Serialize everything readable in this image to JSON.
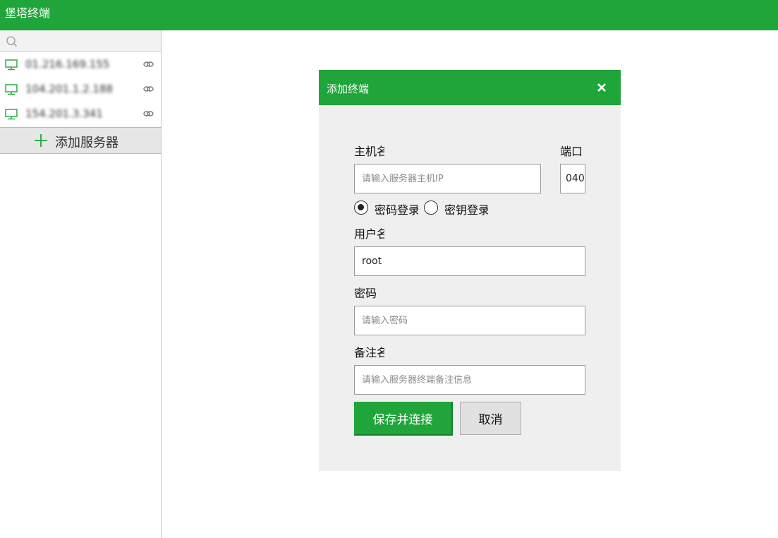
{
  "app": {
    "title": "堡塔终端"
  },
  "sidebar": {
    "search": {
      "placeholder": "",
      "value": ""
    },
    "servers": [
      {
        "ip": "01.216.169.155"
      },
      {
        "ip": "104.201.1.2.188"
      },
      {
        "ip": "154.201.3.341"
      }
    ],
    "add_server_label": "添加服务器"
  },
  "dialog": {
    "title": "添加终端",
    "host_label": "主机名",
    "host_placeholder": "请输入服务器主机IP",
    "port_label": "端口",
    "port_value": "040",
    "auth_options": [
      {
        "label": "密码登录",
        "selected": true
      },
      {
        "label": "密钥登录",
        "selected": false
      }
    ],
    "user_label": "用户名",
    "user_value": "root",
    "password_label": "密码",
    "password_placeholder": "请输入密码",
    "remark_label": "备注名",
    "remark_placeholder": "请输入服务器终端备注信息",
    "save_label": "保存并连接",
    "cancel_label": "取消"
  },
  "colors": {
    "accent": "#20a53a",
    "dialog_bg": "#efefef"
  },
  "icons": [
    "search-icon",
    "monitor-icon",
    "link-icon",
    "plus-icon",
    "close-icon"
  ]
}
